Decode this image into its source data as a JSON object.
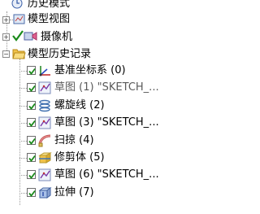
{
  "tree": {
    "history_mode": "历史模式",
    "model_views": "模型视图",
    "camera": "摄像机",
    "model_history": "模型历史记录",
    "items": [
      {
        "label": "基准坐标系 (0)",
        "checked": true,
        "muted": false,
        "icon": "datum-csys-icon"
      },
      {
        "label": "草图 (1) \"SKETCH_...",
        "checked": true,
        "muted": true,
        "icon": "sketch-icon"
      },
      {
        "label": "螺旋线 (2)",
        "checked": true,
        "muted": false,
        "icon": "helix-icon"
      },
      {
        "label": "草图 (3) \"SKETCH_...",
        "checked": true,
        "muted": false,
        "icon": "sketch-icon"
      },
      {
        "label": "扫掠 (4)",
        "checked": true,
        "muted": false,
        "icon": "swept-icon"
      },
      {
        "label": "修剪体 (5)",
        "checked": true,
        "muted": false,
        "icon": "trim-body-icon"
      },
      {
        "label": "草图 (6) \"SKETCH_...",
        "checked": true,
        "muted": false,
        "icon": "sketch-icon"
      },
      {
        "label": "拉伸 (7)",
        "checked": true,
        "muted": false,
        "icon": "extrude-icon"
      }
    ]
  },
  "colors": {
    "check": "#1a8a1a",
    "folder": "#f0c24a",
    "muted_text": "#5a5a5a"
  }
}
